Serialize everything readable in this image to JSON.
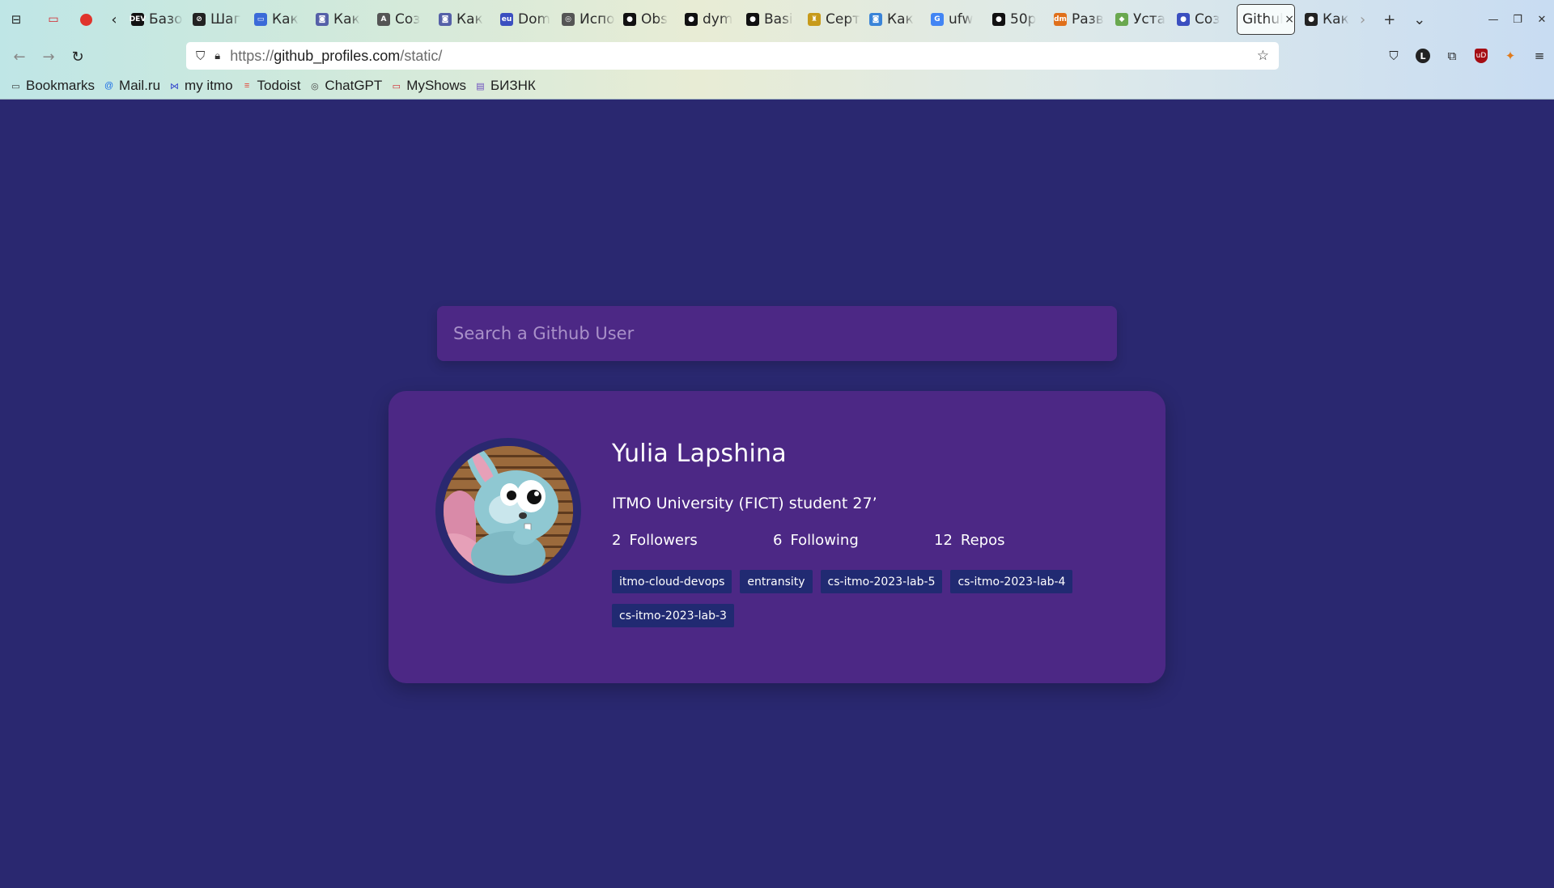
{
  "browser": {
    "tabs": [
      {
        "title": "Базо",
        "fav": "DEV",
        "color": "#111111"
      },
      {
        "title": "Шаг",
        "fav": "⊘",
        "color": "#222222"
      },
      {
        "title": "Как",
        "fav": "▭",
        "color": "#3b6ad8"
      },
      {
        "title": "Как",
        "fav": "◙",
        "color": "#5560a8"
      },
      {
        "title": "Соз",
        "fav": "A",
        "color": "#555555"
      },
      {
        "title": "Как",
        "fav": "◙",
        "color": "#5560a8"
      },
      {
        "title": "Dom",
        "fav": "eu",
        "color": "#3b4fc0"
      },
      {
        "title": "Испо",
        "fav": "◎",
        "color": "#555555"
      },
      {
        "title": "Obs",
        "fav": "●",
        "color": "#111111"
      },
      {
        "title": "dym",
        "fav": "●",
        "color": "#111111"
      },
      {
        "title": "Basi",
        "fav": "●",
        "color": "#111111"
      },
      {
        "title": "Серт",
        "fav": "♜",
        "color": "#c79a1a"
      },
      {
        "title": "Как",
        "fav": "◙",
        "color": "#3a84d8"
      },
      {
        "title": "ufw",
        "fav": "G",
        "color": "#4285f4"
      },
      {
        "title": "50p",
        "fav": "●",
        "color": "#111111"
      },
      {
        "title": "Разв",
        "fav": "dm",
        "color": "#e0701b"
      },
      {
        "title": "Уста",
        "fav": "◆",
        "color": "#6aa84f"
      },
      {
        "title": "Соз",
        "fav": "●",
        "color": "#3b4fc0"
      }
    ],
    "active_tab": {
      "title": "Github",
      "close": "×"
    },
    "after_tab": {
      "title": "Как",
      "fav": "●",
      "color": "#222222"
    },
    "url": {
      "proto": "https://",
      "host": "github_profiles.com",
      "path": "/static/"
    },
    "bookmarks": [
      {
        "label": "Bookmarks",
        "icon": "folder-icon",
        "glyph": "▭",
        "color": "#333333"
      },
      {
        "label": "Mail.ru",
        "icon": "mailru-icon",
        "glyph": "@",
        "color": "#1a6ee6"
      },
      {
        "label": "my itmo",
        "icon": "itmo-icon",
        "glyph": "⋈",
        "color": "#3344cc"
      },
      {
        "label": "Todoist",
        "icon": "todoist-icon",
        "glyph": "≡",
        "color": "#e44332"
      },
      {
        "label": "ChatGPT",
        "icon": "chatgpt-icon",
        "glyph": "◎",
        "color": "#444444"
      },
      {
        "label": "MyShows",
        "icon": "myshows-icon",
        "glyph": "▭",
        "color": "#d2232a"
      },
      {
        "label": "БИЗНК",
        "icon": "biznk-icon",
        "glyph": "▤",
        "color": "#6b4bbf"
      }
    ]
  },
  "search": {
    "placeholder": "Search a Github User"
  },
  "profile": {
    "name": "Yulia Lapshina",
    "bio": "ITMO University (FICT) student 27’",
    "stats": {
      "followers": {
        "value": "2",
        "label": "Followers"
      },
      "following": {
        "value": "6",
        "label": "Following"
      },
      "repos": {
        "value": "12",
        "label": "Repos"
      }
    },
    "repos": [
      "itmo-cloud-devops",
      "entransity",
      "cs-itmo-2023-lab-5",
      "cs-itmo-2023-lab-4",
      "cs-itmo-2023-lab-3"
    ]
  },
  "colors": {
    "background": "#2a2870",
    "card": "#4c2885",
    "repo_tag": "#212a72"
  }
}
